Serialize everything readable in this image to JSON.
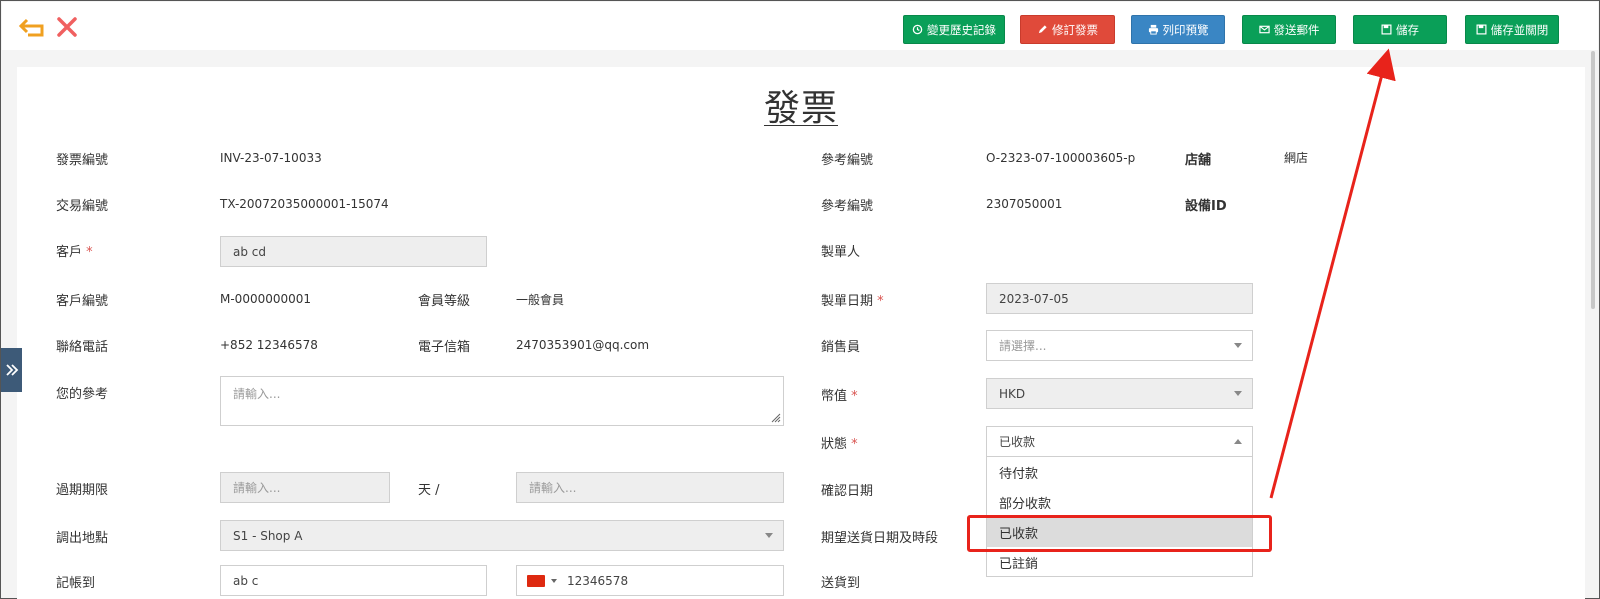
{
  "toolbar": {
    "buttons": [
      {
        "label": "變更歷史記錄"
      },
      {
        "label": "修訂發票"
      },
      {
        "label": "列印預覽"
      },
      {
        "label": "發送郵件"
      },
      {
        "label": "儲存"
      },
      {
        "label": "儲存並關閉"
      }
    ],
    "colors": {
      "green": "#0a9f58",
      "red": "#e04a3a",
      "blue": "#3a86c4",
      "back_icon": "#f0a020",
      "close_icon": "#f06060"
    }
  },
  "page_title": "發票",
  "form": {
    "invoice_no_label": "發票編號",
    "invoice_no": "INV-23-07-10033",
    "transaction_no_label": "交易編號",
    "transaction_no": "TX-20072035000001-15074",
    "customer_label": "客戶",
    "customer": "ab cd",
    "customer_no_label": "客戶編號",
    "customer_no": "M-0000000001",
    "member_level_label": "會員等級",
    "member_level": "一般會員",
    "phone_label": "聯絡電話",
    "phone": "+852 12346578",
    "email_label": "電子信箱",
    "email": "2470353901@qq.com",
    "your_ref_label": "您的參考",
    "your_ref_placeholder": "請輸入...",
    "due_label": "過期期限",
    "due_placeholder": "請輸入...",
    "days_label": "天 /",
    "due2_placeholder": "請輸入...",
    "ship_from_label": "調出地點",
    "ship_from": "S1 - Shop A",
    "bill_to_label": "記帳到",
    "bill_to": "ab c",
    "bill_phone": "12346578",
    "ref_no_label": "參考編號",
    "ref_no": "O-2323-07-100003605-p",
    "shop_label": "店舖",
    "shop": "網店",
    "ref_no2_label": "參考編號",
    "ref_no2": "2307050001",
    "device_id_label": "設備ID",
    "creator_label": "製單人",
    "created_date_label": "製單日期",
    "created_date": "2023-07-05",
    "salesperson_label": "銷售員",
    "salesperson_placeholder": "請選擇...",
    "currency_label": "幣值",
    "currency": "HKD",
    "status_label": "狀態",
    "status": "已收款",
    "confirm_date_label": "確認日期",
    "expected_delivery_label": "期望送貨日期及時段",
    "ship_to_label": "送貨到",
    "required_mark": "*"
  },
  "status_options": [
    {
      "label": "待付款"
    },
    {
      "label": "部分收款"
    },
    {
      "label": "已收款",
      "selected": true
    },
    {
      "label": "已註銷"
    }
  ],
  "annotation": {
    "color": "#e8231b"
  }
}
